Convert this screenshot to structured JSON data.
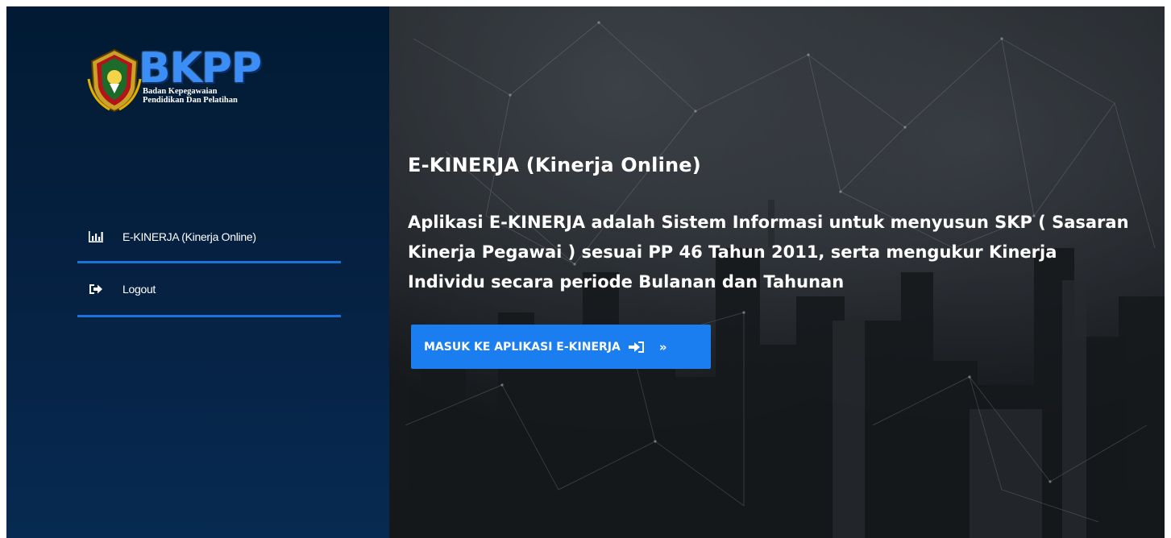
{
  "logo": {
    "title": "BKPP",
    "subtitle_line1": "Badan Kepegawaian",
    "subtitle_line2": "Pendidikan Dan Pelatihan"
  },
  "sidebar": {
    "items": [
      {
        "label": "E-KINERJA (Kinerja Online)",
        "icon": "bar-chart-icon"
      },
      {
        "label": "Logout",
        "icon": "sign-out-icon"
      }
    ]
  },
  "hero": {
    "title": "E-KINERJA (Kinerja Online)",
    "description": "Aplikasi E-KINERJA adalah Sistem Informasi untuk menyusun SKP ( Sasaran Kinerja Pegawai ) sesuai PP 46 Tahun 2011, serta mengukur Kinerja Individu secara periode Bulanan dan Tahunan",
    "button_label": "MASUK KE APLIKASI E-KINERJA",
    "button_icon": "sign-in-icon",
    "button_chevron": "»"
  },
  "colors": {
    "sidebar_bg": "#062244",
    "accent": "#1b7ef0",
    "divider": "#1a73d9",
    "text": "#ffffff"
  }
}
